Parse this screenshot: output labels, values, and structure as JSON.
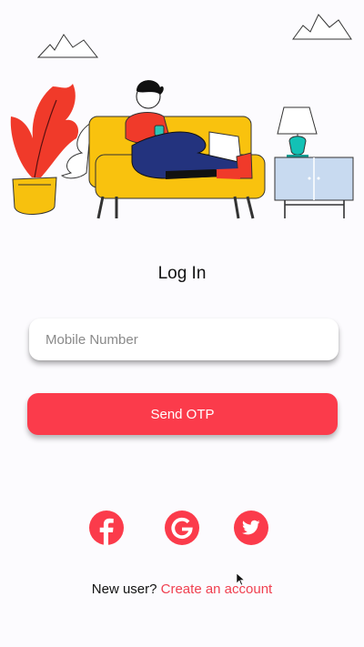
{
  "login": {
    "title": "Log In",
    "mobile_placeholder": "Mobile Number",
    "mobile_value": "",
    "send_otp_label": "Send OTP"
  },
  "social": [
    {
      "name": "facebook",
      "icon": "facebook-icon"
    },
    {
      "name": "google",
      "icon": "google-icon"
    },
    {
      "name": "twitter",
      "icon": "twitter-icon"
    }
  ],
  "signup": {
    "prompt": "New user?",
    "link_label": "Create an account"
  },
  "colors": {
    "accent": "#fb3b4b",
    "link": "#f04050",
    "background": "#fcfbfe",
    "sofa": "#f9c20e",
    "plant": "#f03a2a",
    "cabinet": "#c8daf0",
    "lamp": "#13c1b5"
  }
}
